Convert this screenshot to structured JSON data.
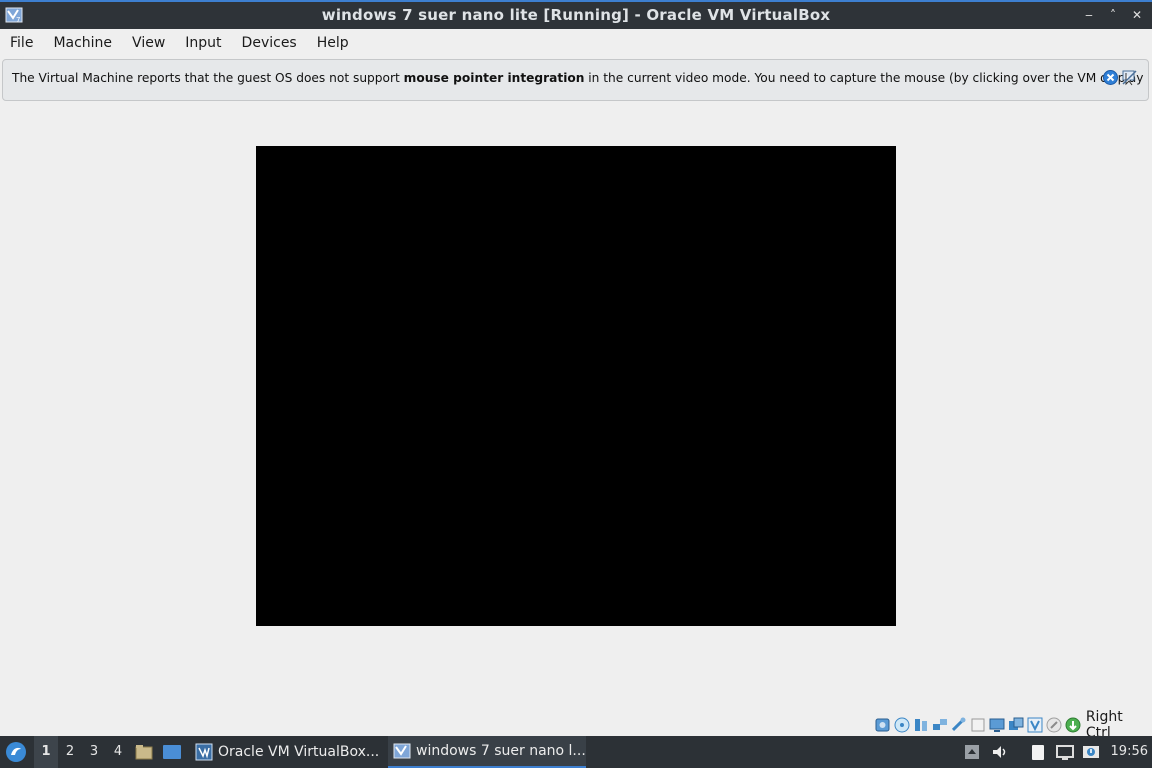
{
  "window": {
    "title": "windows 7 suer nano lite [Running] - Oracle VM VirtualBox",
    "controls": [
      "minimize",
      "maximize",
      "close"
    ]
  },
  "menu": [
    "File",
    "Machine",
    "View",
    "Input",
    "Devices",
    "Help"
  ],
  "notice": {
    "text_before": "The Virtual Machine reports that the guest OS does not support ",
    "text_bold": "mouse pointer integration",
    "text_after": " in the current video mode. You need to capture the mouse (by clicking over the VM display"
  },
  "statusbar": {
    "icons": [
      "hard-disk-icon",
      "optical-drive-icon",
      "audio-icon",
      "network-icon",
      "usb-icon",
      "shared-folders-icon",
      "display-icon",
      "video-capture-icon",
      "virtualization-icon",
      "mouse-integration-icon",
      "keyboard-capture-icon"
    ],
    "host_key": "Right Ctrl"
  },
  "taskbar": {
    "desktops": [
      "1",
      "2",
      "3",
      "4"
    ],
    "active_desktop": "1",
    "tasks": [
      {
        "label": "Oracle VM VirtualBox...",
        "active": false
      },
      {
        "label": "windows 7 suer nano l...",
        "active": true
      }
    ],
    "clock": "19:56"
  },
  "colors": {
    "titlebar": "#2e3338",
    "taskbar": "#2c3136",
    "accent": "#3d7fd0",
    "vm_screen": "#000000"
  }
}
